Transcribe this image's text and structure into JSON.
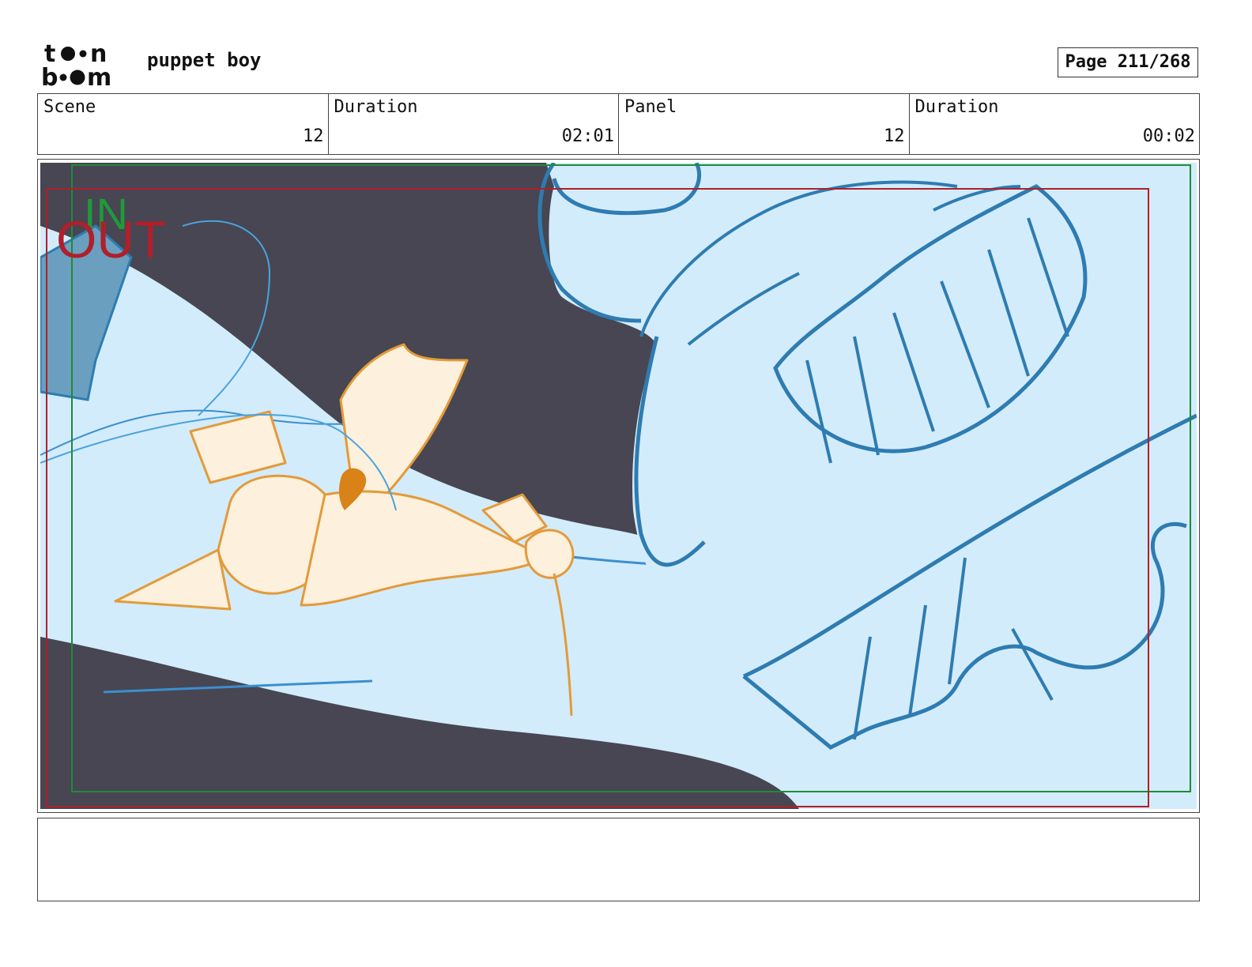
{
  "header": {
    "logo_top": "toon",
    "logo_bottom": "boom",
    "project_title": "puppet boy",
    "page_label": "Page 211/268"
  },
  "info": {
    "scene_label": "Scene",
    "scene_value": "12",
    "scene_duration_label": "Duration",
    "scene_duration_value": "02:01",
    "panel_label": "Panel",
    "panel_value": "12",
    "panel_duration_label": "Duration",
    "panel_duration_value": "00:02"
  },
  "panel": {
    "in_label": "IN",
    "out_label": "OUT",
    "colors": {
      "background_dark": "#474652",
      "sky_light": "#d3ecfb",
      "line_blue": "#2e7cb1",
      "puppet_fill": "#fdf0dc",
      "puppet_line": "#e39a3a",
      "frame_in": "#1f8a3a",
      "frame_out": "#b01f2a"
    }
  },
  "notes": {
    "text": ""
  }
}
